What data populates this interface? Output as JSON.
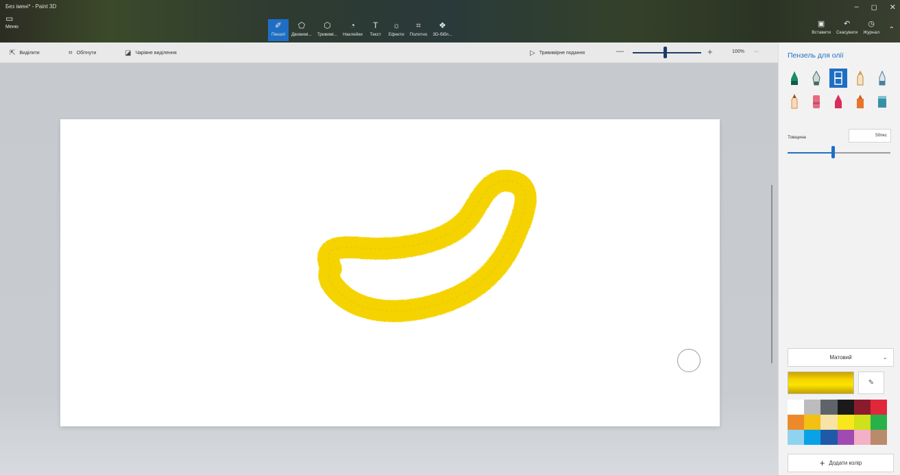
{
  "window": {
    "title": "Без імені* - Paint 3D",
    "controls": [
      "–",
      "◻",
      "✕"
    ]
  },
  "menu": {
    "label": "Меню",
    "icon": "folder-icon"
  },
  "tools": [
    {
      "label": "Пензлі",
      "icon": "brush-icon",
      "active": true
    },
    {
      "label": "Двовимі...",
      "icon": "2d-shapes-icon",
      "active": false
    },
    {
      "label": "Тривимі...",
      "icon": "3d-shapes-icon",
      "active": false
    },
    {
      "label": "Наклейки",
      "icon": "stickers-icon",
      "active": false
    },
    {
      "label": "Текст",
      "icon": "text-icon",
      "active": false
    },
    {
      "label": "Ефекти",
      "icon": "effects-icon",
      "active": false
    },
    {
      "label": "Полотно",
      "icon": "canvas-icon",
      "active": false
    },
    {
      "label": "3D-бібл...",
      "icon": "3d-library-icon",
      "active": false
    }
  ],
  "right_actions": [
    {
      "label": "Вставити",
      "icon": "paste-icon"
    },
    {
      "label": "Скасувати",
      "icon": "undo-icon"
    },
    {
      "label": "Журнал",
      "icon": "history-icon"
    }
  ],
  "subbar": {
    "select": "Виділити",
    "crop": "Обітнути",
    "magic_select": "Чарівне виділення",
    "view_3d": "Тривимірне подання",
    "zoom_minus": "—",
    "zoom_plus": "+",
    "zoom": "100%",
    "more": "···",
    "zoom_level": 0.45
  },
  "panel": {
    "title": "Пензель для олії",
    "brushes": [
      {
        "name": "marker-brush-icon",
        "color": "#1c8a6a",
        "selected": false
      },
      {
        "name": "calligraphy-pen-icon",
        "color": "#7fa39a",
        "selected": false
      },
      {
        "name": "oil-brush-icon",
        "color": "#1e6fc4",
        "selected": true
      },
      {
        "name": "watercolor-brush-icon",
        "color": "#e0a548",
        "selected": false
      },
      {
        "name": "pixel-pen-icon",
        "color": "#4a7fa0",
        "selected": false
      },
      {
        "name": "pencil-icon",
        "color": "#e08a3c",
        "selected": false
      },
      {
        "name": "eraser-icon",
        "color": "#e56b82",
        "selected": false
      },
      {
        "name": "crayon-icon",
        "color": "#d92d5e",
        "selected": false
      },
      {
        "name": "spray-can-icon",
        "color": "#e8732a",
        "selected": false
      },
      {
        "name": "fill-bucket-icon",
        "color": "#3a8fa6",
        "selected": false
      }
    ],
    "thickness_label": "Товщина",
    "thickness_value": "50пкс",
    "thickness_level": 0.44,
    "finish": "Матовий",
    "current_color": "#f6d400",
    "palette": [
      "#ffffff",
      "#bcbcbc",
      "#5e6469",
      "#1a1a1a",
      "#8a1b2c",
      "#e0283a",
      "#ec8a2a",
      "#f3c013",
      "#f7e3a6",
      "#f8e71c",
      "#cfe01c",
      "#27b14a",
      "#8fd3ee",
      "#0aa2e6",
      "#1e5aa8",
      "#9f4bb2",
      "#f3b0c6",
      "#b98a6c"
    ],
    "add_color": "Додати колір"
  }
}
